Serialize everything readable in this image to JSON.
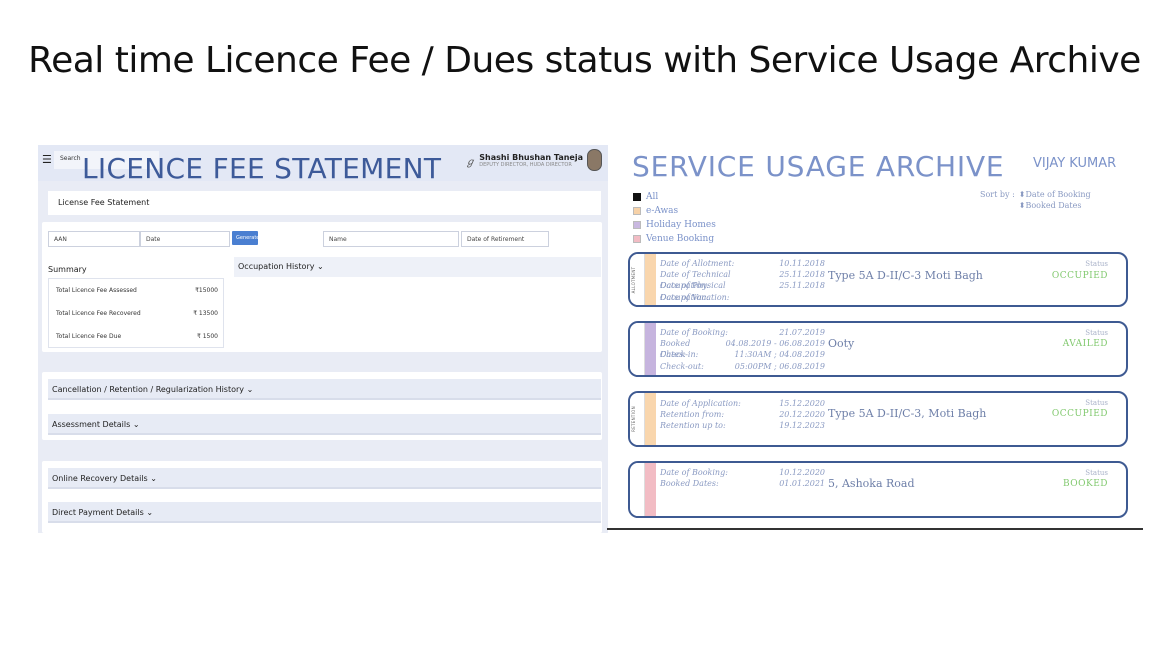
{
  "slide": {
    "title": "Real time Licence Fee / Dues status with Service Usage Archive"
  },
  "licence": {
    "overlay_title": "LICENCE FEE STATEMENT",
    "search_label": "Search",
    "user": {
      "name": "Shashi Bhushan Taneja",
      "role": "DEPUTY DIRECTOR, HUDA DIRECTOR"
    },
    "card_header": "License Fee Statement",
    "fields": {
      "aan": "AAN",
      "date": "Date",
      "search_button": "Generate",
      "name": "Name",
      "date_of_retirement": "Date of Retirement"
    },
    "summary": {
      "title": "Summary",
      "rows": [
        {
          "label": "Total Licence Fee Assessed",
          "value": "₹15000"
        },
        {
          "label": "Total Licence Fee Recovered",
          "value": "₹ 13500"
        },
        {
          "label": "Total Licence Fee Due",
          "value": "₹ 1500"
        }
      ]
    },
    "occupation_history": "Occupation History",
    "accordions": {
      "cancellation": "Cancellation / Retention / Regularization History",
      "assessment": "Assessment Details",
      "online_recovery": "Online Recovery Details",
      "direct_payment": "Direct Payment Details"
    },
    "chevron": "⌄"
  },
  "archive": {
    "title": "SERVICE USAGE ARCHIVE",
    "user": "VIJAY KUMAR",
    "filters": [
      {
        "label": "All",
        "color": "#111111"
      },
      {
        "label": "e-Awas",
        "color": "#f7d2a8"
      },
      {
        "label": "Holiday Homes",
        "color": "#c9b8e0"
      },
      {
        "label": "Venue Booking",
        "color": "#f2bcc4"
      }
    ],
    "sort_by": "Sort by :",
    "sort_options": [
      "Date of Booking",
      "Booked Dates"
    ],
    "status_label": "Status",
    "records": [
      {
        "strip": "ALLOTMENT",
        "color": "#f9d6ad",
        "details": [
          [
            "Date of Allotment:",
            "10.11.2018"
          ],
          [
            "Date of Technical Occupation:",
            "25.11.2018"
          ],
          [
            "Date of Physical Occupation:",
            "25.11.2018"
          ],
          [
            "Date of Vacation:",
            ""
          ]
        ],
        "place": "Type 5A D-II/C-3 Moti Bagh",
        "status": "OCCUPIED"
      },
      {
        "strip": "",
        "color": "#c6b4de",
        "details": [
          [
            "Date of Booking:",
            "21.07.2019"
          ],
          [
            "Booked Dates:",
            "04.08.2019 - 06.08.2019"
          ],
          [
            "Check-in:",
            "11:30AM ; 04.08.2019"
          ],
          [
            "Check-out:",
            "05:00PM ; 06.08.2019"
          ]
        ],
        "place": "Ooty",
        "status": "AVAILED"
      },
      {
        "strip": "RETENTION",
        "color": "#f9d6ad",
        "details": [
          [
            "Date of Application:",
            "15.12.2020"
          ],
          [
            "Retention from:",
            "20.12.2020"
          ],
          [
            "Retention up to:",
            "19.12.2023"
          ]
        ],
        "place": "Type 5A D-II/C-3, Moti Bagh",
        "status": "OCCUPIED"
      },
      {
        "strip": "",
        "color": "#f2bcc4",
        "details": [
          [
            "Date of Booking:",
            "10.12.2020"
          ],
          [
            "Booked Dates:",
            "01.01.2021"
          ]
        ],
        "place": "5, Ashoka Road",
        "status": "BOOKED"
      }
    ]
  }
}
